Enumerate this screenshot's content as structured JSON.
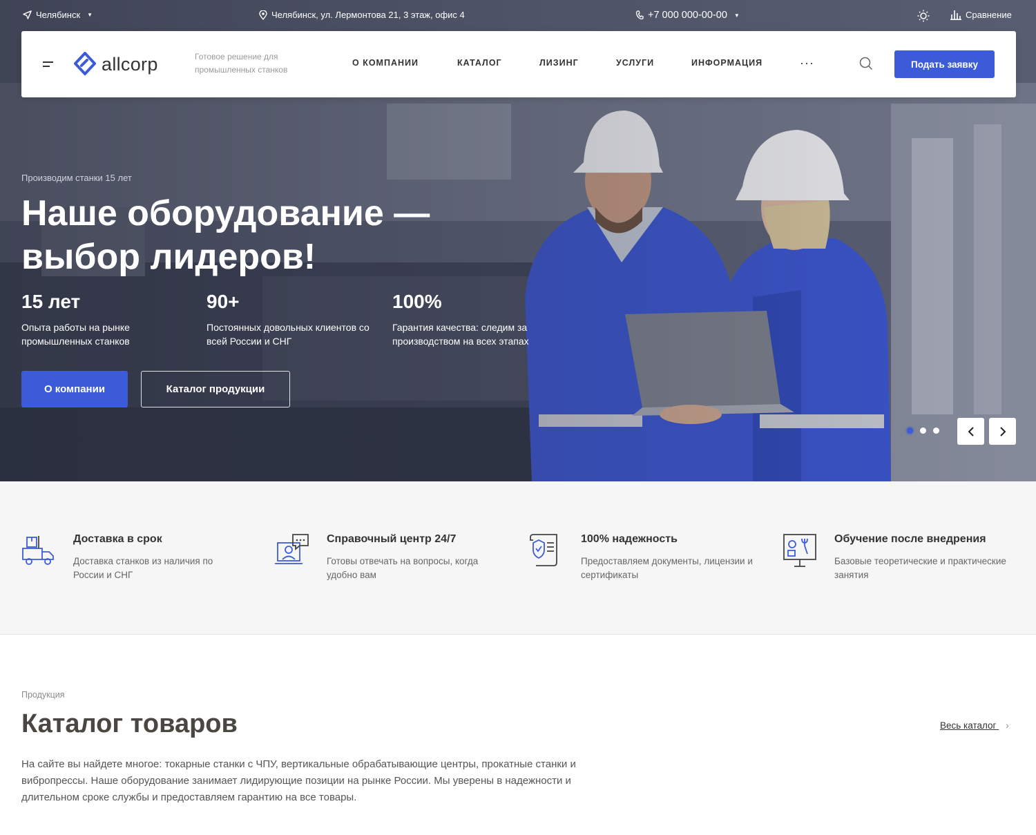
{
  "topbar": {
    "city": "Челябинск",
    "address": "Челябинск, ул. Лермонтова 21, 3 этаж, офис 4",
    "phone": "+7 000 000-00-00",
    "compare": "Сравнение"
  },
  "header": {
    "logo_text": "allcorp",
    "tagline": "Готовое решение для промышленных станков",
    "nav": [
      "О КОМПАНИИ",
      "КАТАЛОГ",
      "ЛИЗИНГ",
      "УСЛУГИ",
      "ИНФОРМАЦИЯ"
    ],
    "more": "···",
    "cta_label": "Подать заявку"
  },
  "hero": {
    "kicker": "Производим станки 15 лет",
    "title": "Наше оборудование — выбор лидеров!",
    "stats": [
      {
        "num": "15 лет",
        "desc": "Опыта работы на рынке промышленных станков"
      },
      {
        "num": "90+",
        "desc": "Постоянных довольных клиентов со всей России и СНГ"
      },
      {
        "num": "100%",
        "desc": "Гарантия качества: следим за производством на всех этапах"
      }
    ],
    "btn_primary": "О компании",
    "btn_secondary": "Каталог продукции",
    "slides": 3,
    "active_slide": 1
  },
  "features": [
    {
      "icon": "delivery-truck-icon",
      "title": "Доставка в срок",
      "text": "Доставка станков из наличия по России и СНГ"
    },
    {
      "icon": "support-center-icon",
      "title": "Справочный центр 24/7",
      "text": "Готовы отвечать на вопросы, когда удобно вам"
    },
    {
      "icon": "shield-document-icon",
      "title": "100% надежность",
      "text": "Предоставляем документы, лицензии и сертификаты"
    },
    {
      "icon": "training-board-icon",
      "title": "Обучение после внедрения",
      "text": "Базовые теоретические и практические занятия"
    }
  ],
  "catalog": {
    "kicker": "Продукция",
    "title": "Каталог товаров",
    "all_link": "Весь каталог",
    "description": "На сайте вы найдете многое: токарные станки с ЧПУ, вертикальные обрабатывающие центры, прокатные станки и вибропрессы. Наше оборудование занимает лидирующие позиции на рынке России. Мы уверены в надежности и длительном сроке службы и предоставляем гарантию на все товары."
  },
  "colors": {
    "accent": "#3b5bd9",
    "worker_jacket": "#3a55d0"
  }
}
